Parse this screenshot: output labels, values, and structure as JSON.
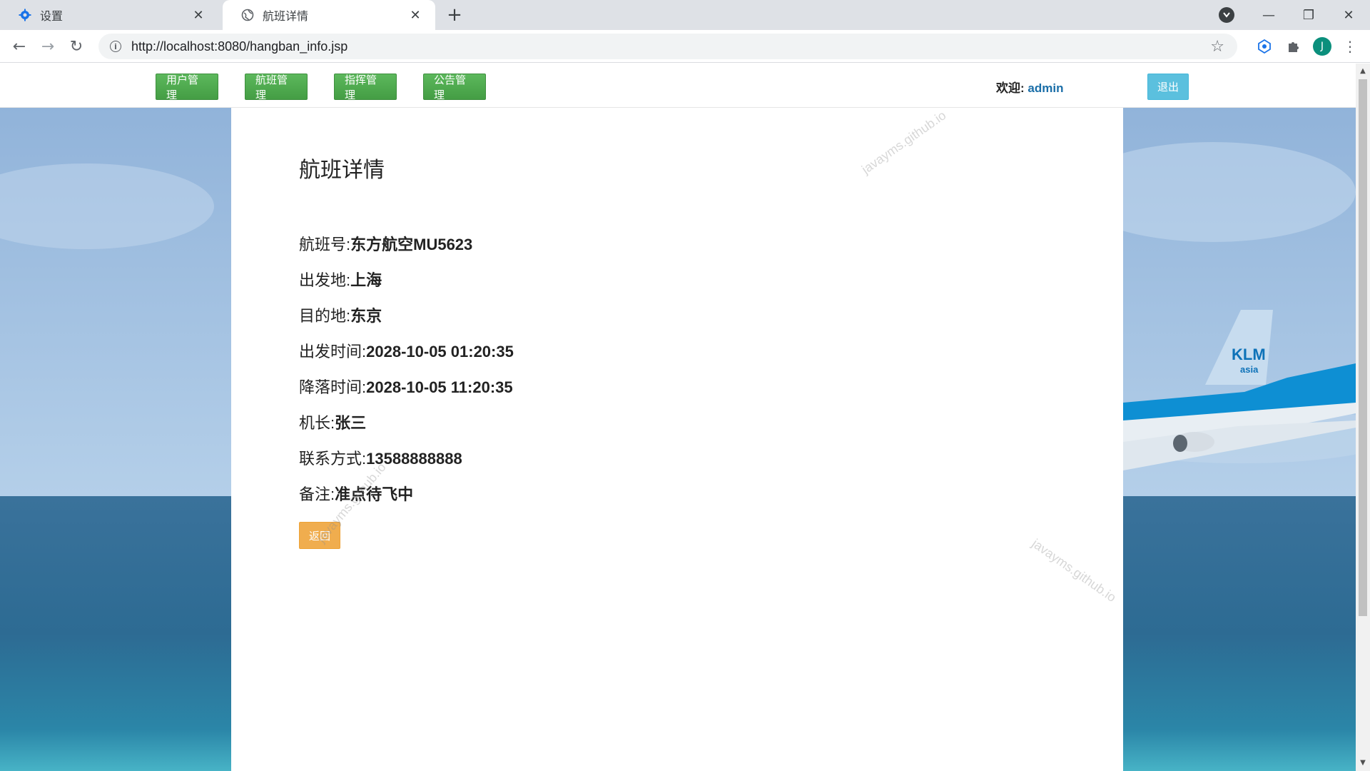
{
  "browser": {
    "tabs": [
      {
        "title": "设置",
        "icon": "gear-icon",
        "active": false
      },
      {
        "title": "航班详情",
        "icon": "globe-icon",
        "active": true
      }
    ],
    "url": "http://localhost:8080/hangban_info.jsp",
    "avatar_letter": "J"
  },
  "nav": {
    "buttons": [
      "用户管理",
      "航班管理",
      "指挥管理",
      "公告管理"
    ],
    "welcome_label": "欢迎:",
    "username": "admin",
    "logout": "退出"
  },
  "detail": {
    "title": "航班详情",
    "fields": [
      {
        "label": "航班号:",
        "value": "东方航空MU5623"
      },
      {
        "label": "出发地:",
        "value": "上海"
      },
      {
        "label": "目的地:",
        "value": "东京"
      },
      {
        "label": "出发时间:",
        "value": "2028-10-05 01:20:35"
      },
      {
        "label": "降落时间:",
        "value": "2028-10-05 11:20:35"
      },
      {
        "label": "机长:",
        "value": "张三"
      },
      {
        "label": "联系方式:",
        "value": "13588888888"
      },
      {
        "label": "备注:",
        "value": "准点待飞中"
      }
    ],
    "back": "返回"
  },
  "watermark": "javayms.github.io",
  "plane_logo": {
    "brand": "KLM",
    "sub": "asia"
  },
  "colors": {
    "nav_green": "#5cb85c",
    "logout_cyan": "#5bc0de",
    "back_orange": "#f0ad4e",
    "username_blue": "#1a6ea8"
  }
}
